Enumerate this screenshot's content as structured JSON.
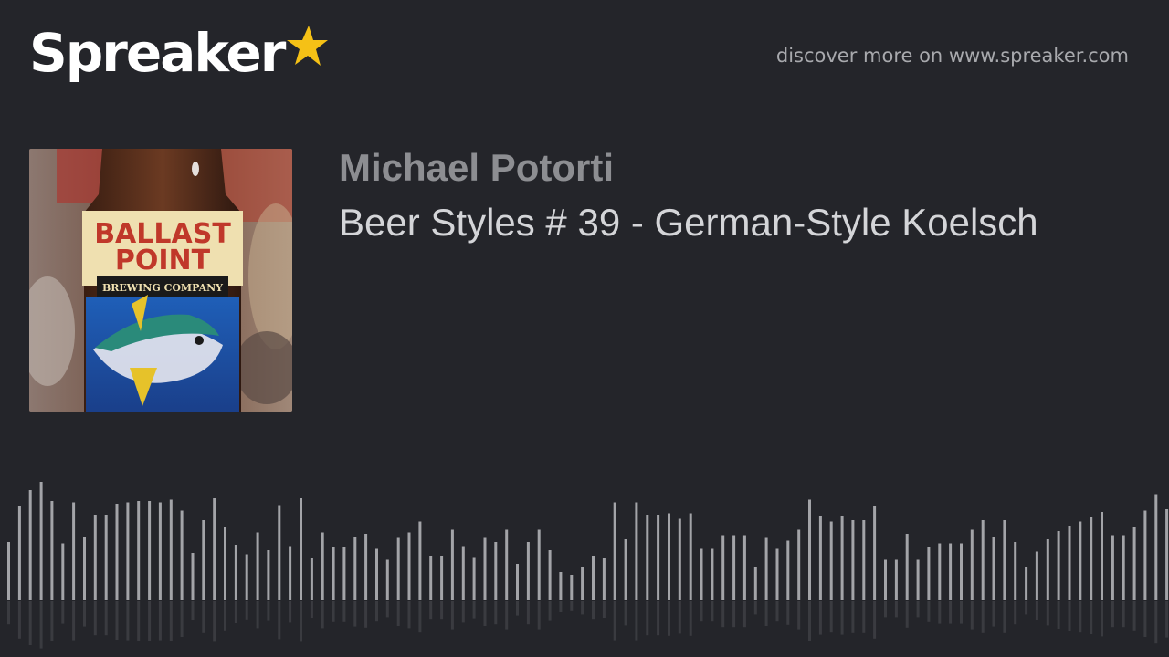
{
  "header": {
    "logo_text": "Spreaker",
    "logo_icon": "star-icon",
    "discover_text": "discover more on www.spreaker.com"
  },
  "episode": {
    "author": "Michael Potorti",
    "title": "Beer Styles # 39 - German-Style Koelsch",
    "cover": {
      "brand_line1": "BALLAST",
      "brand_line2": "POINT",
      "brand_line3": "BREWING COMPANY"
    }
  },
  "waveform": {
    "levels": [
      0.42,
      0.68,
      0.8,
      0.86,
      0.72,
      0.41,
      0.71,
      0.46,
      0.62,
      0.62,
      0.7,
      0.71,
      0.72,
      0.72,
      0.71,
      0.73,
      0.65,
      0.34,
      0.58,
      0.74,
      0.53,
      0.4,
      0.33,
      0.49,
      0.36,
      0.69,
      0.39,
      0.74,
      0.3,
      0.49,
      0.38,
      0.38,
      0.46,
      0.48,
      0.37,
      0.29,
      0.45,
      0.49,
      0.57,
      0.32,
      0.32,
      0.51,
      0.39,
      0.31,
      0.45,
      0.42,
      0.51,
      0.26,
      0.42,
      0.51,
      0.36,
      0.2,
      0.18,
      0.24,
      0.32,
      0.3,
      0.71,
      0.44,
      0.71,
      0.62,
      0.62,
      0.63,
      0.59,
      0.63,
      0.37,
      0.37,
      0.47,
      0.47,
      0.47,
      0.24,
      0.45,
      0.37,
      0.43,
      0.51,
      0.73,
      0.61,
      0.57,
      0.61,
      0.58,
      0.58,
      0.68,
      0.29,
      0.29,
      0.48,
      0.29,
      0.38,
      0.41,
      0.41,
      0.41,
      0.51,
      0.58,
      0.46,
      0.58,
      0.42,
      0.24,
      0.35,
      0.44,
      0.5,
      0.54,
      0.57,
      0.6,
      0.64,
      0.47,
      0.47,
      0.53,
      0.65,
      0.77,
      0.66
    ],
    "colors": {
      "bar": "#a3a4a8",
      "reflection": "#3a3b40"
    }
  },
  "colors": {
    "background": "#24252a",
    "logo_star": "#f5c116",
    "author_text": "#8d8e92",
    "title_text": "#d4d5d8"
  }
}
